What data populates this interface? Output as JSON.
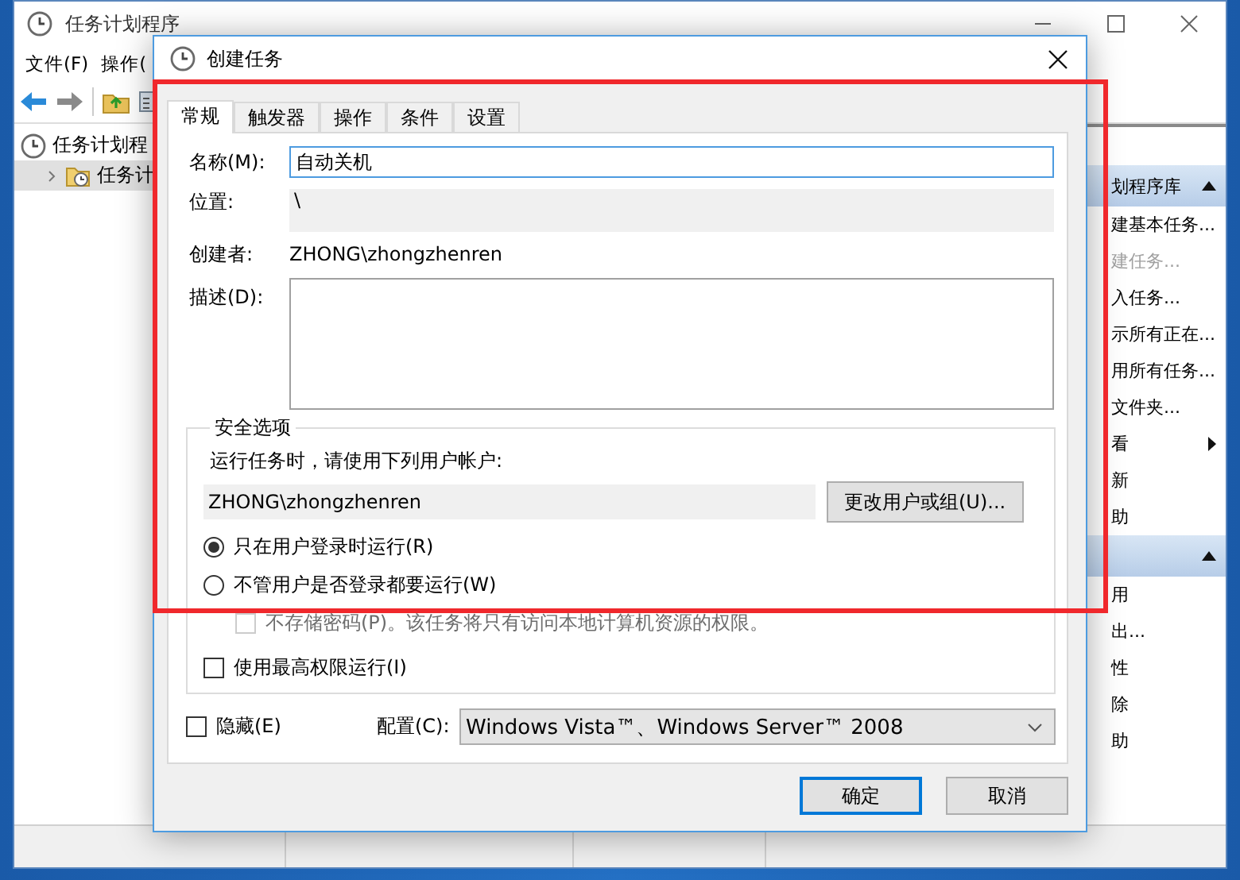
{
  "back_window": {
    "title": "任务计划程序",
    "menu": [
      "文件(F)",
      "操作("
    ],
    "tree": [
      {
        "label": "任务计划程",
        "selected": false,
        "children": [
          {
            "label": "任务计",
            "selected": true,
            "expanded": false
          }
        ]
      }
    ],
    "action_sections": [
      {
        "header": "划程序库",
        "expanded": true,
        "items": [
          {
            "label": "建基本任务...",
            "kind": "command",
            "disabled": false
          },
          {
            "label": "建任务...",
            "kind": "command",
            "disabled": true
          },
          {
            "label": "入任务...",
            "kind": "command",
            "disabled": false
          },
          {
            "label": "示所有正在...",
            "kind": "command",
            "disabled": false
          },
          {
            "label": "用所有任务...",
            "kind": "command",
            "disabled": false
          },
          {
            "label": "文件夹...",
            "kind": "command",
            "disabled": false
          },
          {
            "label": "看",
            "kind": "submenu",
            "disabled": false
          },
          {
            "label": "新",
            "kind": "command",
            "disabled": false
          },
          {
            "label": "助",
            "kind": "command",
            "disabled": false
          }
        ]
      },
      {
        "expanded": true,
        "items": [
          {
            "label": "用",
            "kind": "command",
            "disabled": false
          },
          {
            "label": "出...",
            "kind": "command",
            "disabled": false
          },
          {
            "label": "性",
            "kind": "command",
            "disabled": false
          },
          {
            "label": "除",
            "kind": "command",
            "disabled": false
          },
          {
            "label": "助",
            "kind": "command",
            "disabled": false
          }
        ]
      }
    ]
  },
  "dialog": {
    "title": "创建任务",
    "tabs": [
      {
        "label": "常规",
        "selected": true
      },
      {
        "label": "触发器",
        "selected": false
      },
      {
        "label": "操作",
        "selected": false
      },
      {
        "label": "条件",
        "selected": false
      },
      {
        "label": "设置",
        "selected": false
      }
    ],
    "name": {
      "label": "名称(M):",
      "value": "自动关机"
    },
    "location": {
      "label": "位置:",
      "value": "\\"
    },
    "author": {
      "label": "创建者:",
      "value": "ZHONG\\zhongzhenren"
    },
    "description": {
      "label": "描述(D):"
    },
    "security": {
      "title": "安全选项",
      "prompt": "运行任务时，请使用下列用户帐户:",
      "account": "ZHONG\\zhongzhenren",
      "change_button": "更改用户或组(U)...",
      "run_options": [
        {
          "label": "只在用户登录时运行(R)",
          "selected": true
        },
        {
          "label": "不管用户是否登录都要运行(W)",
          "selected": false
        }
      ],
      "no_store_password": {
        "label": "不存储密码(P)。该任务将只有访问本地计算机资源的权限。",
        "checked": false,
        "disabled": true
      },
      "highest_privileges": {
        "label": "使用最高权限运行(I)",
        "checked": false
      }
    },
    "hidden": {
      "label": "隐藏(E)",
      "checked": false
    },
    "config": {
      "label": "配置(C):",
      "value": "Windows Vista™、Windows Server™ 2008"
    },
    "buttons": [
      {
        "label": "确定",
        "default": true
      },
      {
        "label": "取消",
        "default": false
      }
    ]
  }
}
